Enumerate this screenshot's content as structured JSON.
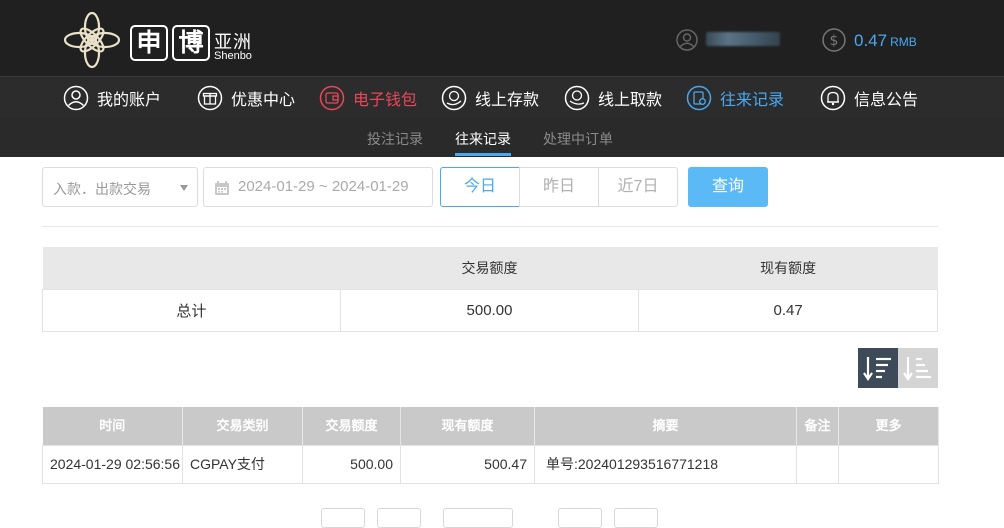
{
  "header": {
    "logo": {
      "cn_box1": "申",
      "cn_box2": "博",
      "cn_text": "亚洲",
      "en_text": "Shenbo"
    },
    "balance": {
      "amount": "0.47",
      "currency": "RMB"
    },
    "accent_color": "#4aa8f0"
  },
  "main_nav": [
    {
      "label": "我的账户",
      "icon": "user-circle-icon"
    },
    {
      "label": "优惠中心",
      "icon": "gift-icon"
    },
    {
      "label": "电子钱包",
      "icon": "wallet-icon",
      "color": "#e8495a"
    },
    {
      "label": "线上存款",
      "icon": "deposit-icon"
    },
    {
      "label": "线上取款",
      "icon": "withdraw-icon"
    },
    {
      "label": "往来记录",
      "icon": "records-icon",
      "active": true
    },
    {
      "label": "信息公告",
      "icon": "bell-icon"
    }
  ],
  "sub_nav": [
    {
      "label": "投注记录"
    },
    {
      "label": "往来记录",
      "active": true
    },
    {
      "label": "处理中订单"
    }
  ],
  "filters": {
    "type_select": "入款．出款交易",
    "date_range": "2024-01-29 ~ 2024-01-29",
    "quick": {
      "today": "今日",
      "yesterday": "昨日",
      "week": "近7日"
    },
    "search_label": "查询"
  },
  "summary": {
    "headers": [
      "",
      "交易额度",
      "现有额度"
    ],
    "row": {
      "label": "总计",
      "amount": "500.00",
      "balance": "0.47"
    }
  },
  "records": {
    "headers": [
      "时间",
      "交易类别",
      "交易额度",
      "现有额度",
      "摘要",
      "备注",
      "更多"
    ],
    "rows": [
      {
        "time": "2024-01-29 02:56:56",
        "category": "CGPAY支付",
        "amount": "500.00",
        "balance": "500.47",
        "summary": "单号:202401293516771218",
        "remark": "",
        "more": ""
      }
    ]
  }
}
